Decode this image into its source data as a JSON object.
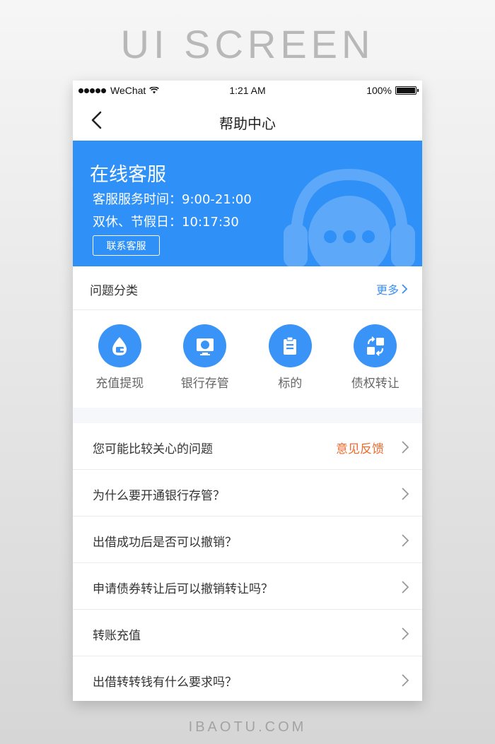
{
  "page": {
    "heading": "UI SCREEN",
    "footer": "IBAOTU.COM"
  },
  "status_bar": {
    "carrier": "WeChat",
    "time": "1:21 AM",
    "battery": "100%"
  },
  "nav": {
    "title": "帮助中心"
  },
  "banner": {
    "title": "在线客服",
    "service_hours": "客服服务时间：9:00-21:00",
    "holiday_hours": "双休、节假日：10:17:30",
    "contact_button": "联系客服",
    "icon": "headset-chat-icon"
  },
  "categories": {
    "title": "问题分类",
    "more": "更多",
    "items": [
      {
        "label": "充值提现",
        "icon": "wallet-drop-icon"
      },
      {
        "label": "银行存管",
        "icon": "deposit-monitor-icon"
      },
      {
        "label": "标的",
        "icon": "clipboard-icon"
      },
      {
        "label": "债权转让",
        "icon": "transfer-icon"
      }
    ]
  },
  "questions": {
    "header": "您可能比较关心的问题",
    "feedback": "意见反馈",
    "items": [
      "为什么要开通银行存管？",
      "出借成功后是否可以撤销？",
      "申请债券转让后可以撤销转让吗？",
      "转账充值",
      "出借转转钱有什么要求吗？"
    ]
  },
  "colors": {
    "primary": "#2f90f7",
    "icon_blue": "#3a94f7",
    "accent_orange": "#f26a2e",
    "link_blue": "#3d8ff5"
  }
}
